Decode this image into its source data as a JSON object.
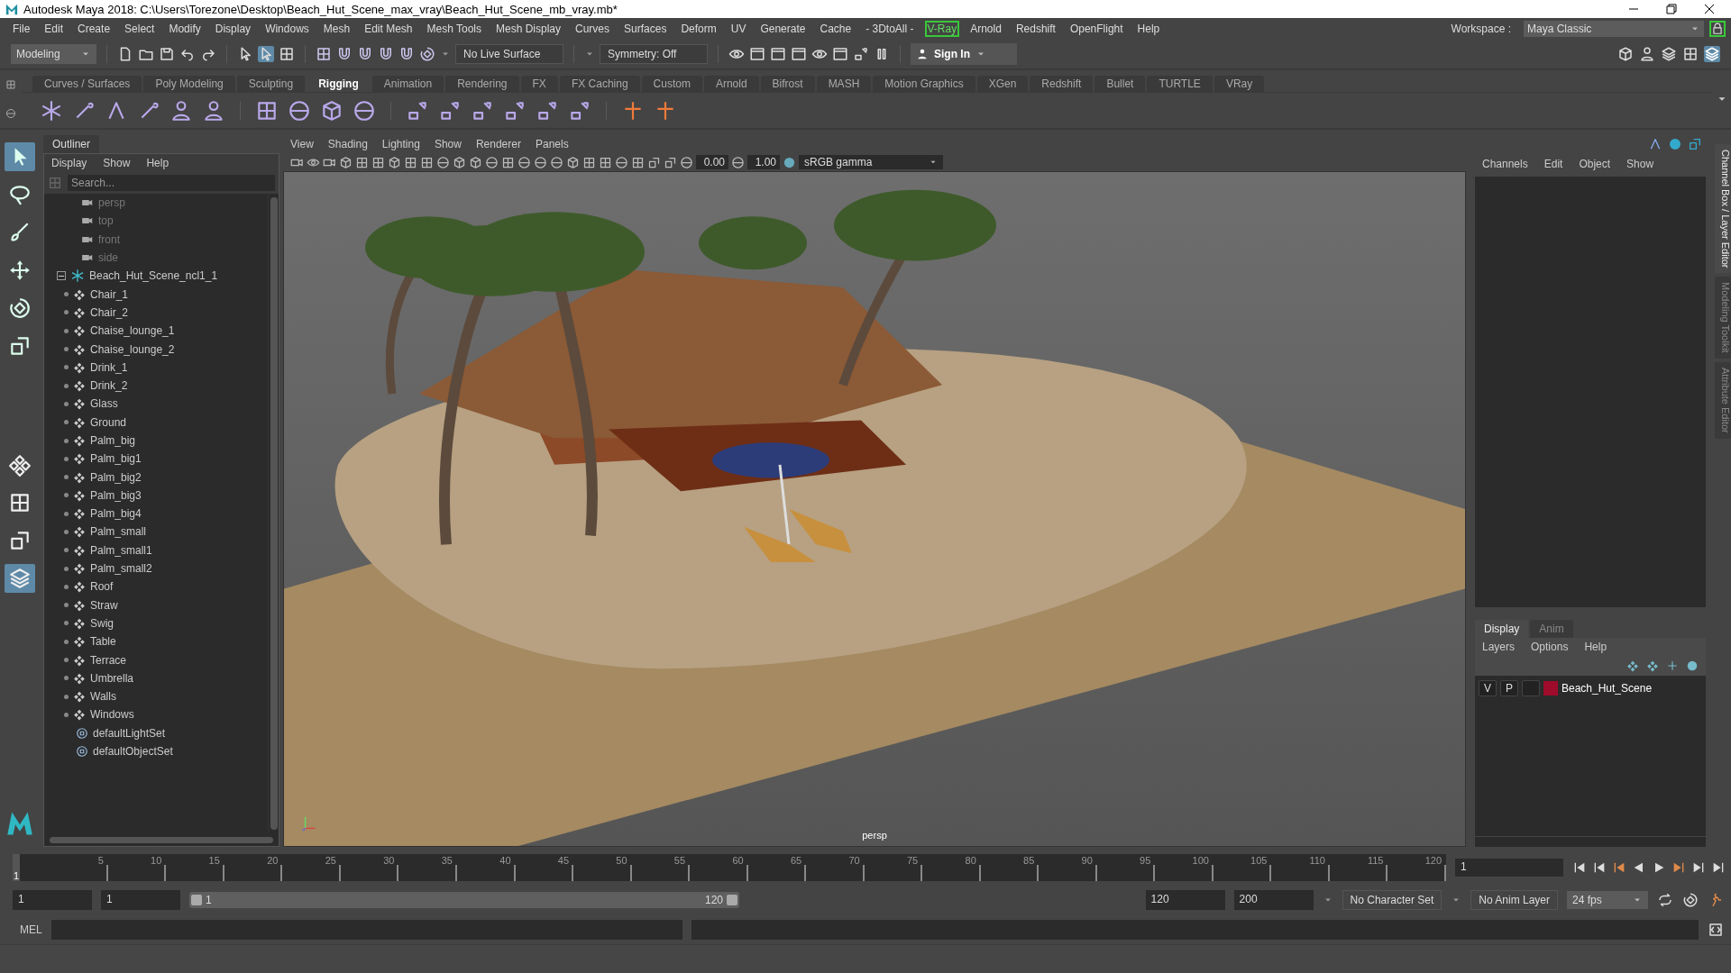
{
  "window": {
    "title": "Autodesk Maya 2018: C:\\Users\\Torezone\\Desktop\\Beach_Hut_Scene_max_vray\\Beach_Hut_Scene_mb_vray.mb*"
  },
  "menu_bar": {
    "items": [
      {
        "label": "File",
        "kind": "menu"
      },
      {
        "label": "Edit",
        "kind": "menu"
      },
      {
        "label": "Create",
        "kind": "menu"
      },
      {
        "label": "Select",
        "kind": "menu"
      },
      {
        "label": "Modify",
        "kind": "menu"
      },
      {
        "label": "Display",
        "kind": "menu"
      },
      {
        "label": "Windows",
        "kind": "menu"
      },
      {
        "label": "Mesh",
        "kind": "menu"
      },
      {
        "label": "Edit Mesh",
        "kind": "menu"
      },
      {
        "label": "Mesh Tools",
        "kind": "menu"
      },
      {
        "label": "Mesh Display",
        "kind": "menu"
      },
      {
        "label": "Curves",
        "kind": "menu"
      },
      {
        "label": "Surfaces",
        "kind": "menu"
      },
      {
        "label": "Deform",
        "kind": "menu"
      },
      {
        "label": "UV",
        "kind": "menu"
      },
      {
        "label": "Generate",
        "kind": "menu"
      },
      {
        "label": "Cache",
        "kind": "menu"
      },
      {
        "label": "- 3DtoAll -",
        "kind": "menu"
      },
      {
        "label": "V-Ray",
        "kind": "plugin"
      },
      {
        "label": "Arnold",
        "kind": "menu"
      },
      {
        "label": "Redshift",
        "kind": "menu"
      },
      {
        "label": "OpenFlight",
        "kind": "menu"
      },
      {
        "label": "Help",
        "kind": "menu"
      }
    ],
    "workspace_label": "Workspace :",
    "workspace": "Maya Classic"
  },
  "status_line": {
    "mode": "Modeling",
    "live_surface": "No Live Surface",
    "symmetry": "Symmetry: Off",
    "sign_in": "Sign In"
  },
  "shelf": {
    "tabs": [
      {
        "label": "Curves / Surfaces",
        "selected": false
      },
      {
        "label": "Poly Modeling",
        "selected": false
      },
      {
        "label": "Sculpting",
        "selected": false
      },
      {
        "label": "Rigging",
        "selected": true
      },
      {
        "label": "Animation",
        "selected": false
      },
      {
        "label": "Rendering",
        "selected": false
      },
      {
        "label": "FX",
        "selected": false
      },
      {
        "label": "FX Caching",
        "selected": false
      },
      {
        "label": "Custom",
        "selected": false
      },
      {
        "label": "Arnold",
        "selected": false
      },
      {
        "label": "Bifrost",
        "selected": false
      },
      {
        "label": "MASH",
        "selected": false
      },
      {
        "label": "Motion Graphics",
        "selected": false
      },
      {
        "label": "XGen",
        "selected": false
      },
      {
        "label": "Redshift",
        "selected": false
      },
      {
        "label": "Bullet",
        "selected": false
      },
      {
        "label": "TURTLE",
        "selected": false
      },
      {
        "label": "VRay",
        "selected": false
      }
    ]
  },
  "outliner": {
    "title": "Outliner",
    "menus": [
      "Display",
      "Show",
      "Help"
    ],
    "search": {
      "placeholder": "Search..."
    },
    "items": [
      {
        "label": "persp",
        "kind": "camera"
      },
      {
        "label": "top",
        "kind": "camera"
      },
      {
        "label": "front",
        "kind": "camera"
      },
      {
        "label": "side",
        "kind": "camera"
      },
      {
        "label": "Beach_Hut_Scene_ncl1_1",
        "kind": "group",
        "expanded": true,
        "children": [
          {
            "label": "Chair_1",
            "kind": "mesh"
          },
          {
            "label": "Chair_2",
            "kind": "mesh"
          },
          {
            "label": "Chaise_lounge_1",
            "kind": "mesh"
          },
          {
            "label": "Chaise_lounge_2",
            "kind": "mesh"
          },
          {
            "label": "Drink_1",
            "kind": "mesh"
          },
          {
            "label": "Drink_2",
            "kind": "mesh"
          },
          {
            "label": "Glass",
            "kind": "mesh"
          },
          {
            "label": "Ground",
            "kind": "mesh"
          },
          {
            "label": "Palm_big",
            "kind": "mesh"
          },
          {
            "label": "Palm_big1",
            "kind": "mesh"
          },
          {
            "label": "Palm_big2",
            "kind": "mesh"
          },
          {
            "label": "Palm_big3",
            "kind": "mesh"
          },
          {
            "label": "Palm_big4",
            "kind": "mesh"
          },
          {
            "label": "Palm_small",
            "kind": "mesh"
          },
          {
            "label": "Palm_small1",
            "kind": "mesh"
          },
          {
            "label": "Palm_small2",
            "kind": "mesh"
          },
          {
            "label": "Roof",
            "kind": "mesh"
          },
          {
            "label": "Straw",
            "kind": "mesh"
          },
          {
            "label": "Swig",
            "kind": "mesh"
          },
          {
            "label": "Table",
            "kind": "mesh"
          },
          {
            "label": "Terrace",
            "kind": "mesh"
          },
          {
            "label": "Umbrella",
            "kind": "mesh"
          },
          {
            "label": "Walls",
            "kind": "mesh"
          },
          {
            "label": "Windows",
            "kind": "mesh"
          }
        ]
      },
      {
        "label": "defaultLightSet",
        "kind": "set"
      },
      {
        "label": "defaultObjectSet",
        "kind": "set"
      }
    ]
  },
  "viewport": {
    "menus": [
      "View",
      "Shading",
      "Lighting",
      "Show",
      "Renderer",
      "Panels"
    ],
    "exposure": "0.00",
    "gamma": "1.00",
    "color_space": "sRGB gamma",
    "camera_label": "persp"
  },
  "channel_box": {
    "menus": [
      "Channels",
      "Edit",
      "Object",
      "Show"
    ]
  },
  "layer_editor": {
    "tabs": [
      {
        "label": "Display",
        "selected": true
      },
      {
        "label": "Anim",
        "selected": false
      }
    ],
    "menus": [
      "Layers",
      "Options",
      "Help"
    ],
    "layers": [
      {
        "visible": "V",
        "playback": "P",
        "name": "Beach_Hut_Scene",
        "color": "#9e0b2b"
      }
    ]
  },
  "side_tabs": [
    {
      "label": "Channel Box / Layer Editor",
      "selected": true
    },
    {
      "label": "Modeling Toolkit",
      "selected": false
    },
    {
      "label": "Attribute Editor",
      "selected": false
    }
  ],
  "time_slider": {
    "level": 0,
    "current_marker": "1",
    "ticks": [
      "5",
      "10",
      "15",
      "20",
      "25",
      "30",
      "35",
      "40",
      "45",
      "50",
      "55",
      "60",
      "65",
      "70",
      "75",
      "80",
      "85",
      "90",
      "95",
      "100",
      "105",
      "110",
      "115",
      "120"
    ],
    "current_frame": "1"
  },
  "range_slider": {
    "level": 1,
    "start": "1",
    "playback_start": "1",
    "range_start": "1",
    "range_end": "120",
    "playback_end": "120",
    "end": "200",
    "character_set": "No Character Set",
    "anim_layer": "No Anim Layer",
    "fps": "24 fps"
  },
  "command_line": {
    "label": "MEL"
  }
}
